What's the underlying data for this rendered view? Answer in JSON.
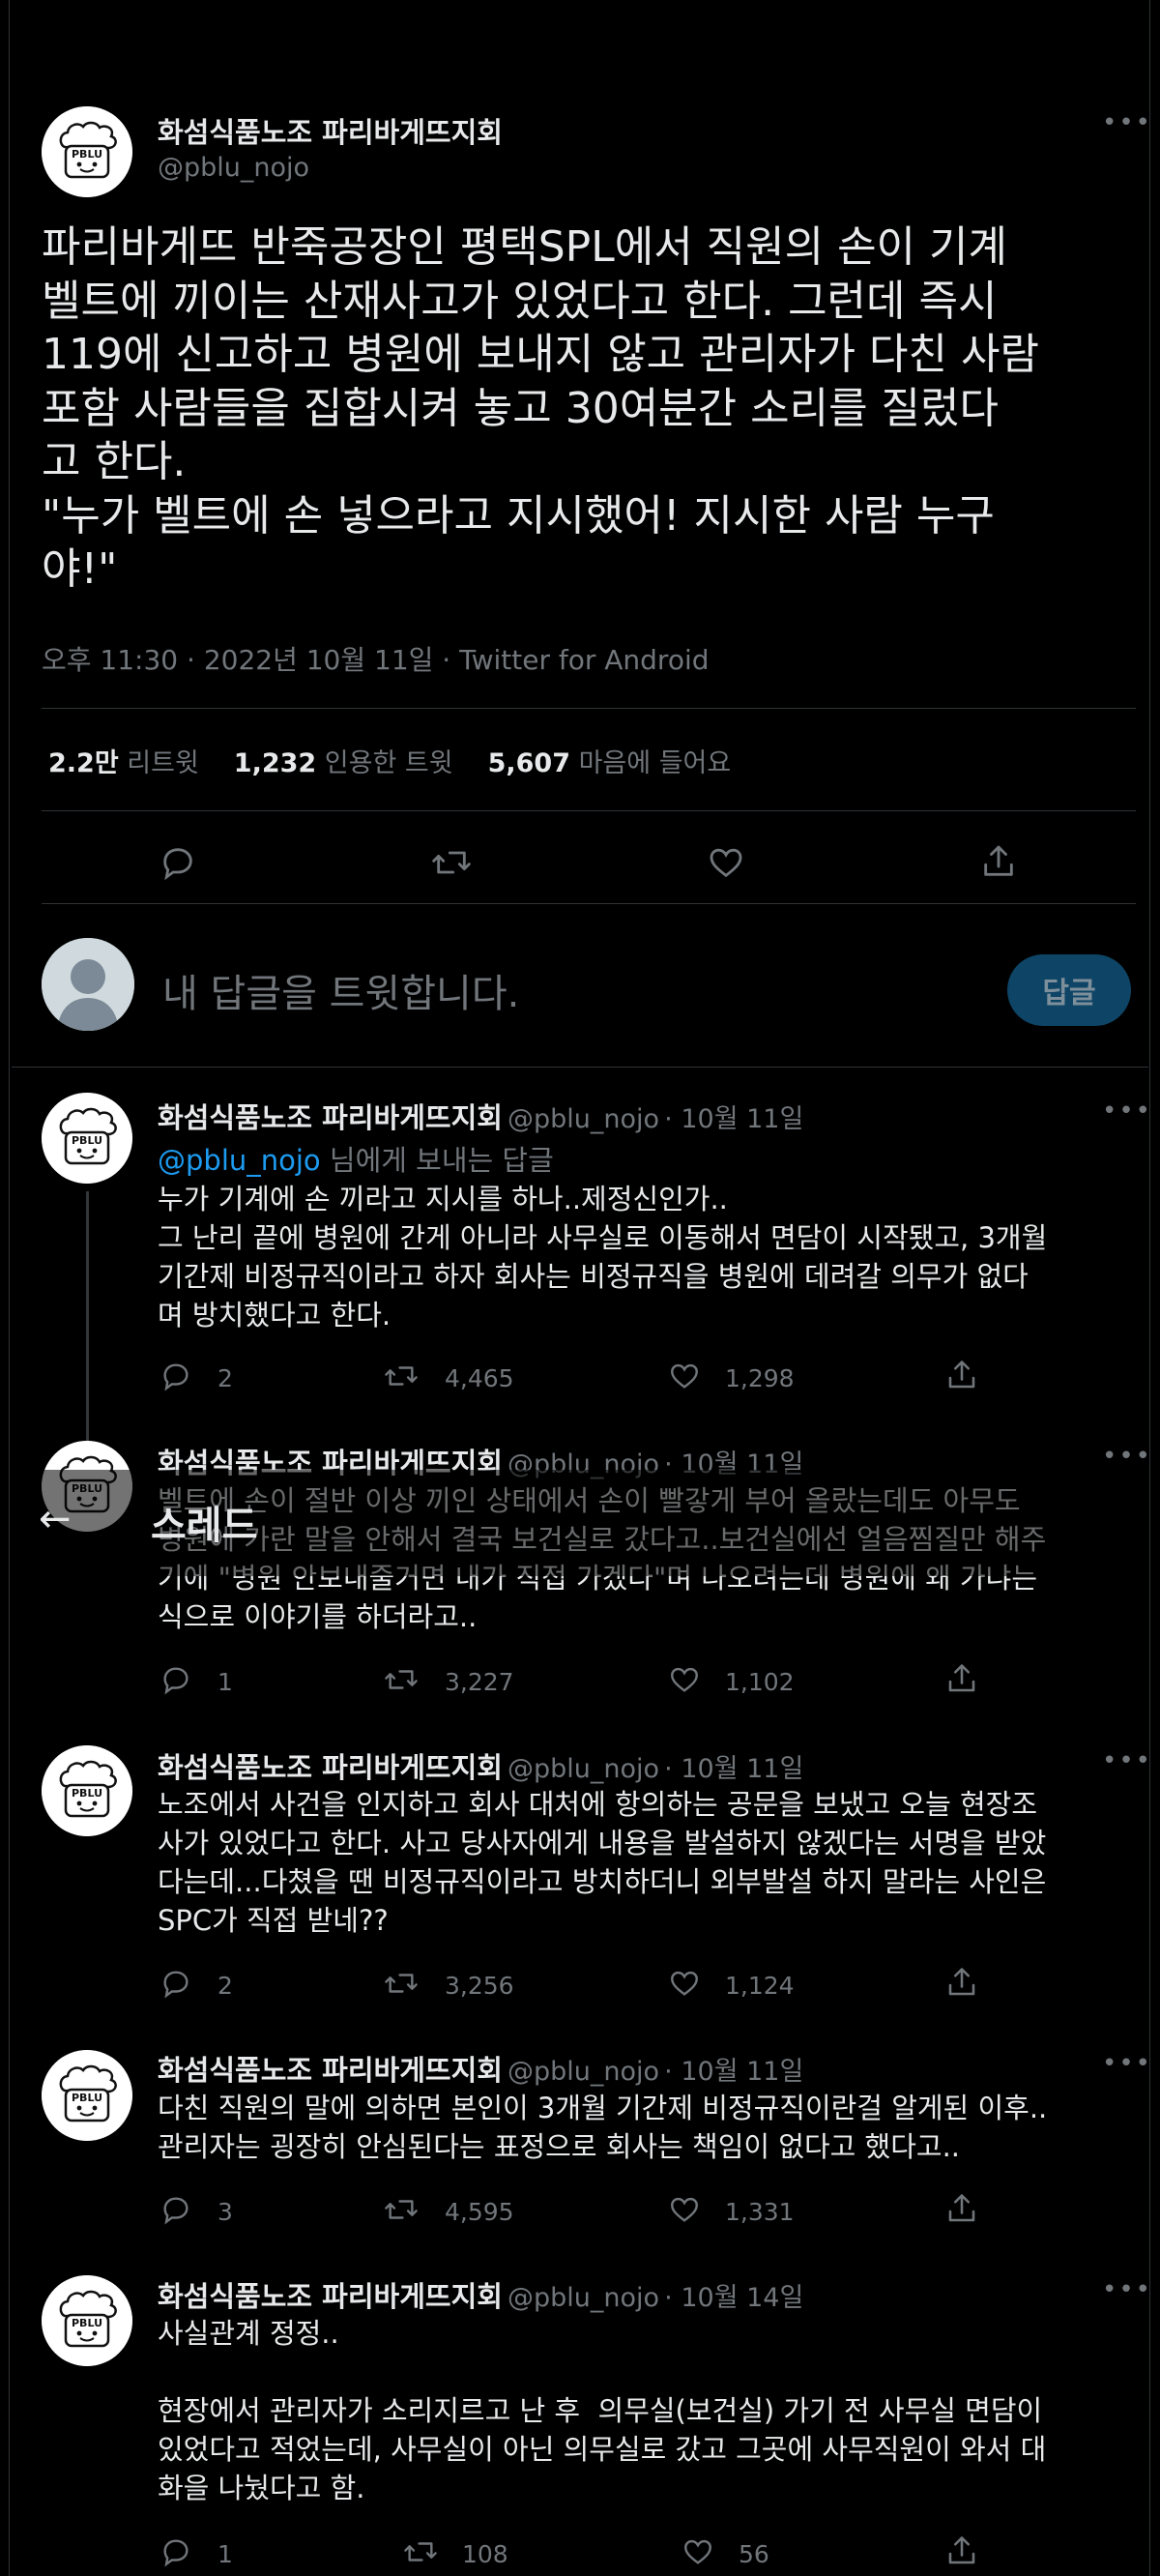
{
  "main_tweet": {
    "author_name": "화섬식품노조 파리바게뜨지회",
    "author_handle": "@pblu_nojo",
    "avatar_text": "PBLU",
    "body": "파리바게뜨 반죽공장인 평택SPL에서 직원의 손이 기계\n벨트에 끼이는 산재사고가 있었다고 한다. 그런데 즉시\n119에 신고하고 병원에 보내지 않고 관리자가 다친 사람\n포함 사람들을 집합시켜 놓고 30여분간 소리를 질렀다\n고 한다.\n\"누가 벨트에 손 넣으라고 지시했어! 지시한 사람 누구\n야!\"",
    "meta": "오후 11:30 · 2022년 10월 11일 · Twitter for Android",
    "stats": {
      "retweets_value": "2.2만",
      "retweets_label": "리트윗",
      "quotes_value": "1,232",
      "quotes_label": "인용한 트윗",
      "likes_value": "5,607",
      "likes_label": "마음에 들어요"
    }
  },
  "compose": {
    "placeholder": "내 답글을 트윗합니다.",
    "reply_button": "답글"
  },
  "overlay": {
    "title": "스레드"
  },
  "replies": [
    {
      "name": "화섬식품노조 파리바게뜨지회",
      "handle": "@pblu_nojo",
      "date": "· 10월 11일",
      "replying_to": "@pblu_nojo",
      "replying_suffix": " 님에게 보내는 답글",
      "body": "누가 기계에 손 끼라고 지시를 하나..제정신인가..\n그 난리 끝에 병원에 간게 아니라 사무실로 이동해서 면담이 시작됐고, 3개월\n기간제 비정규직이라고 하자 회사는 비정규직을 병원에 데려갈 의무가 없다\n며 방치했다고 한다.",
      "replies": "2",
      "retweets": "4,465",
      "likes": "1,298"
    },
    {
      "name": "화섬식품노조 파리바게뜨지회",
      "handle": "@pblu_nojo",
      "date": "· 10월 11일",
      "body": "벨트에 손이 절반 이상 끼인 상태에서 손이 빨갛게 부어 올랐는데도 아무도\n병원에 가란 말을 안해서 결국 보건실로 갔다고..보건실에선 얼음찜질만 해주\n기에 \"병원 안보내줄거면 내가 직접 가겠다\"며 나오려는데 병원에 왜 가냐는\n식으로 이야기를 하더라고..",
      "replies": "1",
      "retweets": "3,227",
      "likes": "1,102"
    },
    {
      "name": "화섬식품노조 파리바게뜨지회",
      "handle": "@pblu_nojo",
      "date": "· 10월 11일",
      "body": "노조에서 사건을 인지하고 회사 대처에 항의하는 공문을 보냈고 오늘 현장조\n사가 있었다고 한다. 사고 당사자에게 내용을 발설하지 않겠다는 서명을 받았\n다는데...다쳤을 땐 비정규직이라고 방치하더니 외부발설 하지 말라는 사인은\nSPC가 직접 받네??",
      "replies": "2",
      "retweets": "3,256",
      "likes": "1,124"
    },
    {
      "name": "화섬식품노조 파리바게뜨지회",
      "handle": "@pblu_nojo",
      "date": "· 10월 11일",
      "body": "다친 직원의 말에 의하면 본인이 3개월 기간제 비정규직이란걸 알게된 이후..\n관리자는 굉장히 안심된다는 표정으로 회사는 책임이 없다고 했다고..",
      "replies": "3",
      "retweets": "4,595",
      "likes": "1,331"
    },
    {
      "name": "화섬식품노조 파리바게뜨지회",
      "handle": "@pblu_nojo",
      "date": "· 10월 14일",
      "body": "사실관계 정정..\n\n현장에서 관리자가 소리지르고 난 후  의무실(보건실) 가기 전 사무실 면담이\n있었다고 적었는데, 사무실이 아닌 의무실로 갔고 그곳에 사무직원이 와서 대\n화을 나눴다고 함.",
      "replies": "1",
      "retweets": "108",
      "likes": "56"
    }
  ],
  "icons": {
    "reply": "reply-icon",
    "retweet": "retweet-icon",
    "like": "heart-icon",
    "share": "share-icon",
    "more": "more-icon",
    "back": "back-arrow-icon"
  }
}
